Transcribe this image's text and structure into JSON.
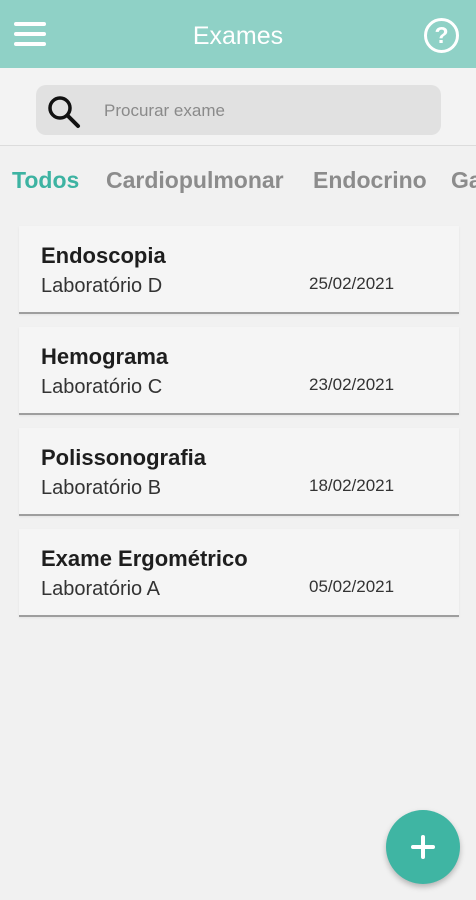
{
  "header": {
    "title": "Exames",
    "menu_icon": "hamburger-menu-icon",
    "help_icon": "help-circle-icon",
    "help_glyph": "?"
  },
  "search": {
    "placeholder": "Procurar exame",
    "icon": "search-icon"
  },
  "tabs": [
    {
      "label": "Todos",
      "active": true
    },
    {
      "label": "Cardiopulmonar",
      "active": false
    },
    {
      "label": "Endocrino",
      "active": false
    },
    {
      "label": "Ga",
      "active": false
    }
  ],
  "exams": [
    {
      "name": "Endoscopia",
      "lab": "Laboratório D",
      "date": "25/02/2021"
    },
    {
      "name": "Hemograma",
      "lab": "Laboratório C",
      "date": "23/02/2021"
    },
    {
      "name": "Polissonografia",
      "lab": "Laboratório B",
      "date": "18/02/2021"
    },
    {
      "name": "Exame Ergométrico",
      "lab": "Laboratório A",
      "date": "05/02/2021"
    }
  ],
  "fab": {
    "icon": "plus-icon"
  },
  "colors": {
    "appbar": "#8fd1c6",
    "accent": "#3db3a2",
    "fab": "#3fb5a3"
  }
}
